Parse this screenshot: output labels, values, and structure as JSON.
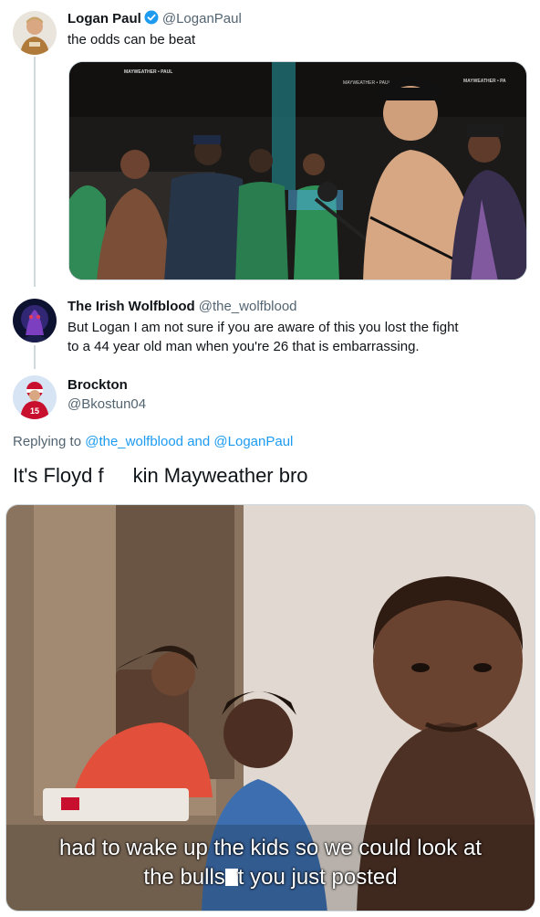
{
  "tweet_original": {
    "name": "Logan Paul",
    "handle": "@LoganPaul",
    "text": "the odds can be beat",
    "media_overlay": [
      "MAYWEATHER • PAUL",
      "MAYWEATHER • PA",
      "MAYWEATHER • PAUL"
    ]
  },
  "tweet_reply1": {
    "name": "The Irish Wolfblood",
    "handle": "@the_wolfblood",
    "text_line1": "But Logan I am not sure if you are aware of this you lost the fight",
    "text_line2": "to a 44 year old man when you're 26 that is embarrassing."
  },
  "tweet_main": {
    "name": "Brockton",
    "handle": "@Bkostun04",
    "replying_prefix": "Replying to",
    "replying_mention1": "@the_wolfblood",
    "replying_and": "and",
    "replying_mention2": "@LoganPaul",
    "text_part1": "It's Floyd f",
    "text_part2": "kin Mayweather bro",
    "meme_caption_line1": "had to wake up the kids so we could look at",
    "meme_caption_line2_a": "the bulls",
    "meme_caption_line2_b": "t you just posted"
  },
  "colors": {
    "link": "#1d9bf0",
    "secondary_text": "#536471",
    "verified_badge": "#1d9bf0",
    "thread_line": "#cfd9de"
  },
  "icons": [
    "verified-badge-icon"
  ]
}
